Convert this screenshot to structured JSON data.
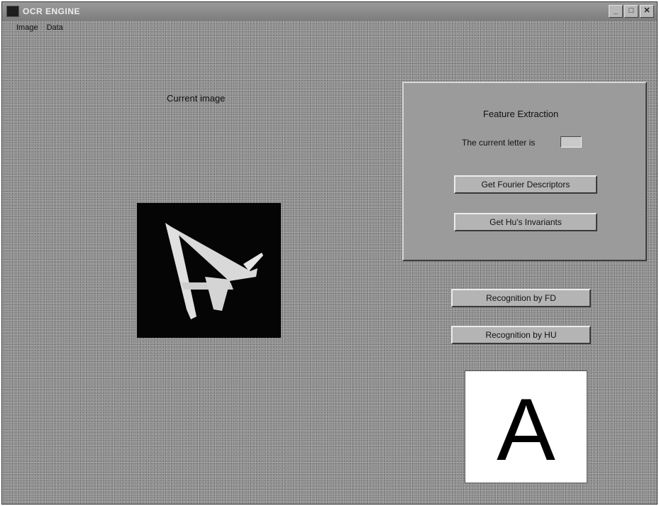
{
  "window": {
    "title": "OCR ENGINE",
    "app_icon_text": "",
    "controls": {
      "minimize": "_",
      "maximize": "□",
      "close": "✕"
    }
  },
  "menu": {
    "items": [
      "Image",
      "Data"
    ]
  },
  "current_image": {
    "label": "Current image"
  },
  "feature_panel": {
    "title": "Feature Extraction",
    "letter_label": "The current letter is",
    "letter_value": "",
    "fourier_button": "Get Fourier Descriptors",
    "hu_button": "Get Hu's Invariants"
  },
  "recognition": {
    "fd_button": "Recognition by FD",
    "hu_button": "Recognition by HU",
    "result_letter": "A"
  },
  "colors": {
    "background": "#8f8f8f",
    "image_background": "#050505",
    "result_background": "#ffffff"
  }
}
